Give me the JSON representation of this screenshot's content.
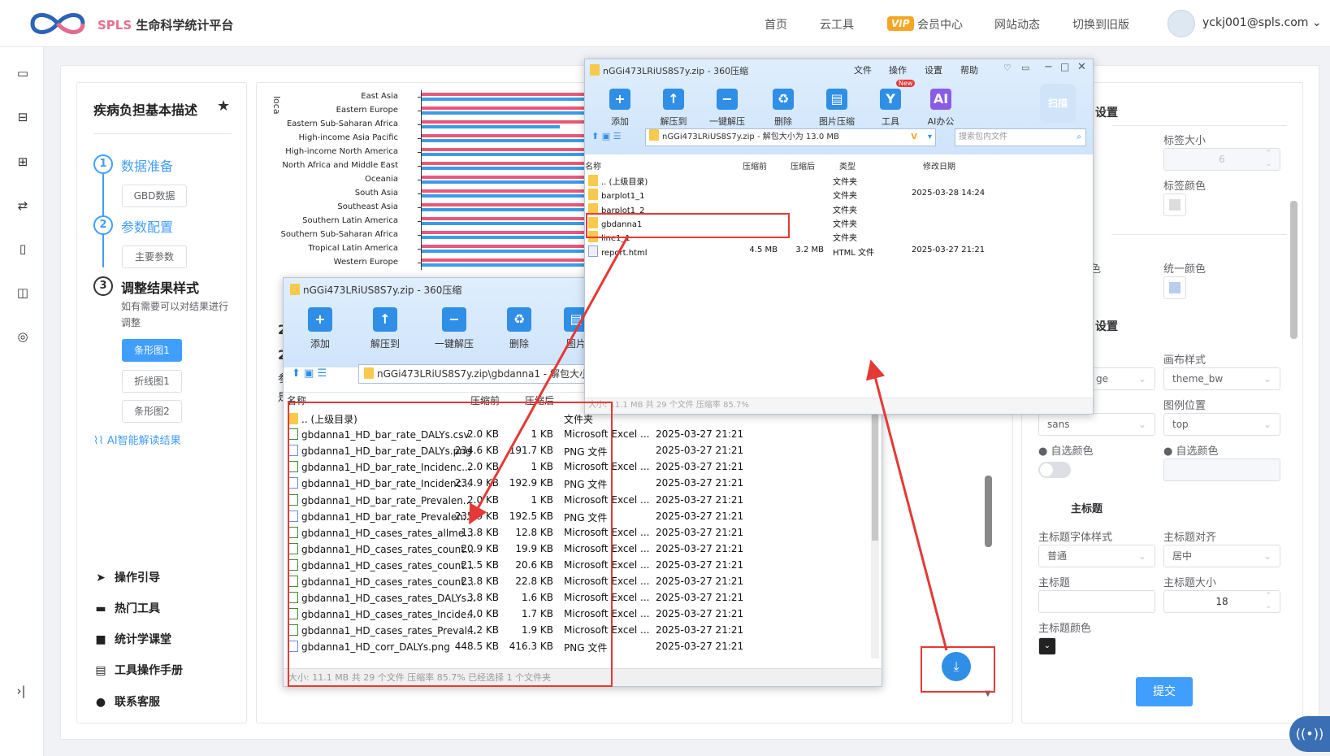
{
  "header": {
    "brand_en": "SPLS",
    "brand_cn": "生命科学统计平台",
    "nav": [
      "首页",
      "云工具",
      "会员中心",
      "网站动态",
      "切换到旧版"
    ],
    "vip_badge": "VIP",
    "user": "yckj001@spls.com"
  },
  "sidebar_icons": [
    "folder-icon",
    "briefcase-icon",
    "toolbox-icon",
    "exchange-icon",
    "bookmark-icon",
    "book-icon",
    "chat-icon"
  ],
  "left_panel": {
    "title": "疾病负担基本描述",
    "steps": [
      {
        "num": "1",
        "label": "数据准备",
        "buttons": [
          "GBD数据"
        ]
      },
      {
        "num": "2",
        "label": "参数配置",
        "buttons": [
          "主要参数"
        ]
      },
      {
        "num": "3",
        "label": "调整结果样式",
        "desc_line1": "如有需要可以对结果进行",
        "desc_line2": "调整",
        "buttons": [
          "条形图1",
          "折线图1",
          "条形图2"
        ]
      }
    ],
    "ai_link": "AI智能解读结果",
    "links": [
      "操作引导",
      "热门工具",
      "统计学课堂",
      "工具操作手册",
      "联系客服"
    ]
  },
  "chart_data": {
    "type": "bar",
    "ylabel": "loca",
    "categories": [
      "East Asia",
      "Eastern Europe",
      "Eastern Sub-Saharan Africa",
      "High-income Asia Pacific",
      "High-income North America",
      "North Africa and Middle East",
      "Oceania",
      "South Asia",
      "Southeast Asia",
      "Southern Latin America",
      "Southern Sub-Saharan Africa",
      "Tropical Latin America",
      "Western Europe"
    ],
    "series": [
      {
        "color": "#e8587a",
        "values": [
          100,
          100,
          100,
          100,
          100,
          100,
          100,
          100,
          100,
          100,
          100,
          100,
          100
        ]
      },
      {
        "color": "#3b9ce6",
        "values": [
          100,
          100,
          85,
          100,
          100,
          100,
          100,
          100,
          100,
          100,
          100,
          100,
          100
        ]
      }
    ]
  },
  "right_panel": {
    "section1_suffix": "设置",
    "label_size_label": "标签大小",
    "label_size_value": "6",
    "label_color_label": "标签颜色",
    "color_suffix": "色",
    "unify_color_label": "统一颜色",
    "section2_suffix": "设置",
    "canvas_style_label": "画布样式",
    "canvas_style_value": "theme_bw",
    "partial_select": "ge",
    "legend_pos_label": "图例位置",
    "font_value": "sans",
    "legend_pos_value": "top",
    "custom_color_label": "自选颜色",
    "main_title_section": "主标题",
    "title_font_label": "主标题字体样式",
    "title_font_value": "普通",
    "title_align_label": "主标题对齐",
    "title_align_value": "居中",
    "title_label": "主标题",
    "title_size_label": "主标题大小",
    "title_size_value": "18",
    "title_color_label": "主标题颜色",
    "submit": "提交"
  },
  "win_top": {
    "title": "nGGi473LRiUS8S7y.zip - 360压缩",
    "menu": [
      "文件",
      "操作",
      "设置",
      "帮助"
    ],
    "tools": [
      "添加",
      "解压到",
      "一键解压",
      "删除",
      "图片压缩",
      "工具",
      "AI办公"
    ],
    "new_badge": "New",
    "scan": "扫描",
    "path": "nGGi473LRiUS8S7y.zip - 解包大小为 13.0 MB",
    "search_placeholder": "搜索包内文件",
    "cols": [
      "名称",
      "压缩前",
      "压缩后",
      "类型",
      "修改日期"
    ],
    "rows": [
      {
        "name": ".. (上级目录)",
        "before": "",
        "after": "",
        "type": "文件夹",
        "date": "",
        "icon": "folder"
      },
      {
        "name": "barplot1_1",
        "before": "",
        "after": "",
        "type": "文件夹",
        "date": "2025-03-28 14:24",
        "icon": "folder"
      },
      {
        "name": "barplot1_2",
        "before": "",
        "after": "",
        "type": "文件夹",
        "date": "",
        "icon": "folder"
      },
      {
        "name": "gbdanna1",
        "before": "",
        "after": "",
        "type": "文件夹",
        "date": "",
        "icon": "folder"
      },
      {
        "name": "line1_1",
        "before": "",
        "after": "",
        "type": "文件夹",
        "date": "",
        "icon": "folder"
      },
      {
        "name": "report.html",
        "before": "4.5 MB",
        "after": "3.2 MB",
        "type": "HTML 文件",
        "date": "2025-03-27 21:21",
        "icon": "htm"
      }
    ],
    "status": "大小: 11.1 MB 共 29 个文件 压缩率 85.7%"
  },
  "win_bottom": {
    "title": "nGGi473LRiUS8S7y.zip - 360压缩",
    "tools": [
      "添加",
      "解压到",
      "一键解压",
      "删除",
      "图片"
    ],
    "path": "nGGi473LRiUS8S7y.zip\\gbdanna1 - 解包大小",
    "cols": [
      "名称",
      "压缩前",
      "压缩后"
    ],
    "rows": [
      {
        "name": ".. (上级目录)",
        "before": "",
        "after": "",
        "type": "文件夹",
        "date": "",
        "icon": "folder"
      },
      {
        "name": "gbdanna1_HD_bar_rate_DALYs.csv",
        "before": "2.0 KB",
        "after": "1 KB",
        "type": "Microsoft Excel ...",
        "date": "2025-03-27 21:21",
        "icon": "doc"
      },
      {
        "name": "gbdanna1_HD_bar_rate_DALYs.png",
        "before": "234.6 KB",
        "after": "191.7 KB",
        "type": "PNG 文件",
        "date": "2025-03-27 21:21",
        "icon": "png"
      },
      {
        "name": "gbdanna1_HD_bar_rate_Incidenc...",
        "before": "2.0 KB",
        "after": "1 KB",
        "type": "Microsoft Excel ...",
        "date": "2025-03-27 21:21",
        "icon": "doc"
      },
      {
        "name": "gbdanna1_HD_bar_rate_Incidenc...",
        "before": "234.9 KB",
        "after": "192.9 KB",
        "type": "PNG 文件",
        "date": "2025-03-27 21:21",
        "icon": "png"
      },
      {
        "name": "gbdanna1_HD_bar_rate_Prevalen...",
        "before": "2.0 KB",
        "after": "1 KB",
        "type": "Microsoft Excel ...",
        "date": "2025-03-27 21:21",
        "icon": "doc"
      },
      {
        "name": "gbdanna1_HD_bar_rate_Prevalen...",
        "before": "235.9 KB",
        "after": "192.5 KB",
        "type": "PNG 文件",
        "date": "2025-03-27 21:21",
        "icon": "png"
      },
      {
        "name": "gbdanna1_HD_cases_rates_allme...",
        "before": "13.8 KB",
        "after": "12.8 KB",
        "type": "Microsoft Excel ...",
        "date": "2025-03-27 21:21",
        "icon": "doc"
      },
      {
        "name": "gbdanna1_HD_cases_rates_count...",
        "before": "20.9 KB",
        "after": "19.9 KB",
        "type": "Microsoft Excel ...",
        "date": "2025-03-27 21:21",
        "icon": "doc"
      },
      {
        "name": "gbdanna1_HD_cases_rates_count...",
        "before": "21.5 KB",
        "after": "20.6 KB",
        "type": "Microsoft Excel ...",
        "date": "2025-03-27 21:21",
        "icon": "doc"
      },
      {
        "name": "gbdanna1_HD_cases_rates_count...",
        "before": "23.8 KB",
        "after": "22.8 KB",
        "type": "Microsoft Excel ...",
        "date": "2025-03-27 21:21",
        "icon": "doc"
      },
      {
        "name": "gbdanna1_HD_cases_rates_DALYs...",
        "before": "3.8 KB",
        "after": "1.6 KB",
        "type": "Microsoft Excel ...",
        "date": "2025-03-27 21:21",
        "icon": "doc"
      },
      {
        "name": "gbdanna1_HD_cases_rates_Incide...",
        "before": "4.0 KB",
        "after": "1.7 KB",
        "type": "Microsoft Excel ...",
        "date": "2025-03-27 21:21",
        "icon": "doc"
      },
      {
        "name": "gbdanna1_HD_cases_rates_Preval...",
        "before": "4.2 KB",
        "after": "1.9 KB",
        "type": "Microsoft Excel ...",
        "date": "2025-03-27 21:21",
        "icon": "doc"
      },
      {
        "name": "gbdanna1_HD_corr_DALYs.png",
        "before": "448.5 KB",
        "after": "416.3 KB",
        "type": "PNG 文件",
        "date": "2025-03-27 21:21",
        "icon": "png"
      }
    ],
    "status": "大小: 11.1 MB 共 29 个文件 压缩率 85.7% 已经选择 1 个文件夹"
  },
  "partial_text": {
    "a": "2",
    "b": "2",
    "c": "参",
    "d": "是"
  }
}
